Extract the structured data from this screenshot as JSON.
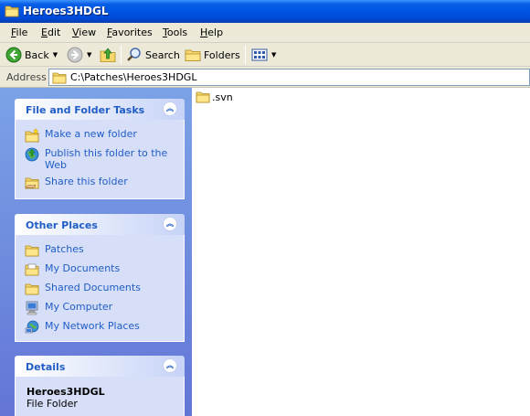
{
  "window": {
    "title": "Heroes3HDGL"
  },
  "menu": [
    {
      "label": "File",
      "key": "F",
      "rest": "ile"
    },
    {
      "label": "Edit",
      "key": "E",
      "rest": "dit"
    },
    {
      "label": "View",
      "key": "V",
      "rest": "iew"
    },
    {
      "label": "Favorites",
      "key": "F",
      "rest": "avorites",
      "prefix": "",
      "underline_pos": 0
    },
    {
      "label": "Tools",
      "key": "T",
      "rest": "ools"
    },
    {
      "label": "Help",
      "key": "H",
      "rest": "elp"
    }
  ],
  "toolbar": {
    "back_label": "Back",
    "search_label": "Search",
    "folders_label": "Folders"
  },
  "address": {
    "label": "Address",
    "path": "C:\\Patches\\Heroes3HDGL"
  },
  "tasks_panel": {
    "title": "File and Folder Tasks",
    "items": [
      {
        "label": "Make a new folder",
        "icon": "new-folder-icon"
      },
      {
        "label": "Publish this folder to the Web",
        "icon": "publish-web-icon"
      },
      {
        "label": "Share this folder",
        "icon": "share-folder-icon"
      }
    ]
  },
  "places_panel": {
    "title": "Other Places",
    "items": [
      {
        "label": "Patches",
        "icon": "folder-icon"
      },
      {
        "label": "My Documents",
        "icon": "my-documents-icon"
      },
      {
        "label": "Shared Documents",
        "icon": "folder-icon"
      },
      {
        "label": "My Computer",
        "icon": "my-computer-icon"
      },
      {
        "label": "My Network Places",
        "icon": "network-places-icon"
      }
    ]
  },
  "details_panel": {
    "title": "Details",
    "name": "Heroes3HDGL",
    "type": "File Folder"
  },
  "files": [
    {
      "name": ".svn",
      "icon": "folder-icon"
    }
  ],
  "colors": {
    "titlebar": "#0054e3",
    "taskpane_bg": "#6375d6",
    "panel_body": "#d6dff7",
    "link": "#215dc6"
  }
}
